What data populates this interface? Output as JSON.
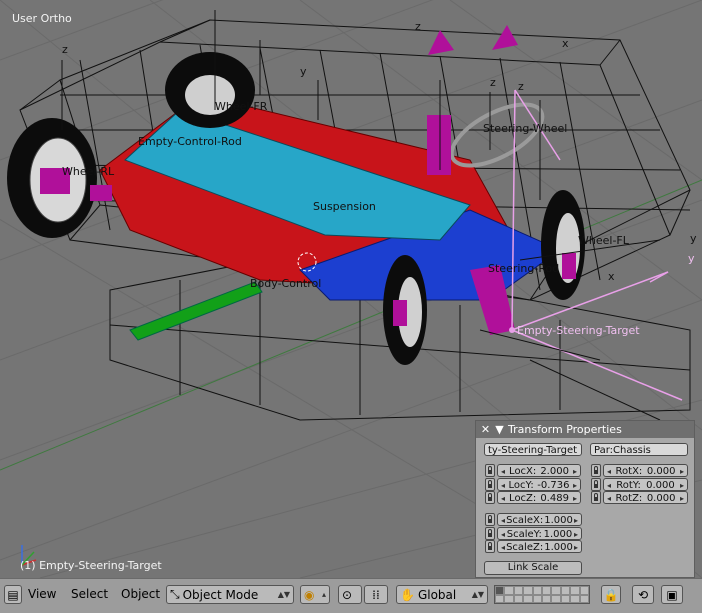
{
  "viewport": {
    "title": "User Ortho",
    "status": "(1) Empty-Steering-Target",
    "object_labels": {
      "control_rod": "Empty-Control-Rod",
      "suspension": "Suspension",
      "steering_wheel": "Steering-Wheel",
      "steering_target": "Empty-Steering-Target",
      "body_control": "Body-Control",
      "wheel_fr": "Wheel-FR",
      "wheel_fl": "Wheel-FL",
      "wheel_rl": "Wheel-RL",
      "steering_rod": "Steering-Rod",
      "axis_z": "z",
      "axis_y": "y",
      "axis_x": "x"
    }
  },
  "transform_panel": {
    "title": "Transform Properties",
    "object_name": "ty-Steering-Target",
    "parent": "Par:Chassis",
    "loc": [
      {
        "label": "LocX:",
        "value": "2.000"
      },
      {
        "label": "LocY:",
        "value": "-0.736"
      },
      {
        "label": "LocZ:",
        "value": "0.489"
      }
    ],
    "rot": [
      {
        "label": "RotX:",
        "value": "0.000"
      },
      {
        "label": "RotY:",
        "value": "0.000"
      },
      {
        "label": "RotZ:",
        "value": "0.000"
      }
    ],
    "scale": [
      {
        "label": "ScaleX:",
        "value": "1.000"
      },
      {
        "label": "ScaleY:",
        "value": "1.000"
      },
      {
        "label": "ScaleZ:",
        "value": "1.000"
      }
    ],
    "link_scale": "Link Scale"
  },
  "header": {
    "menus": [
      "View",
      "Select",
      "Object"
    ],
    "mode": "Object Mode",
    "orientation": "Global"
  },
  "colors": {
    "chassis": "#c8141a",
    "control": "#27a6c8",
    "wheel_hub": "#b0109a",
    "floor": "#1c3fd0",
    "green_bone": "#12a018",
    "target_line": "#e8a0e8"
  }
}
